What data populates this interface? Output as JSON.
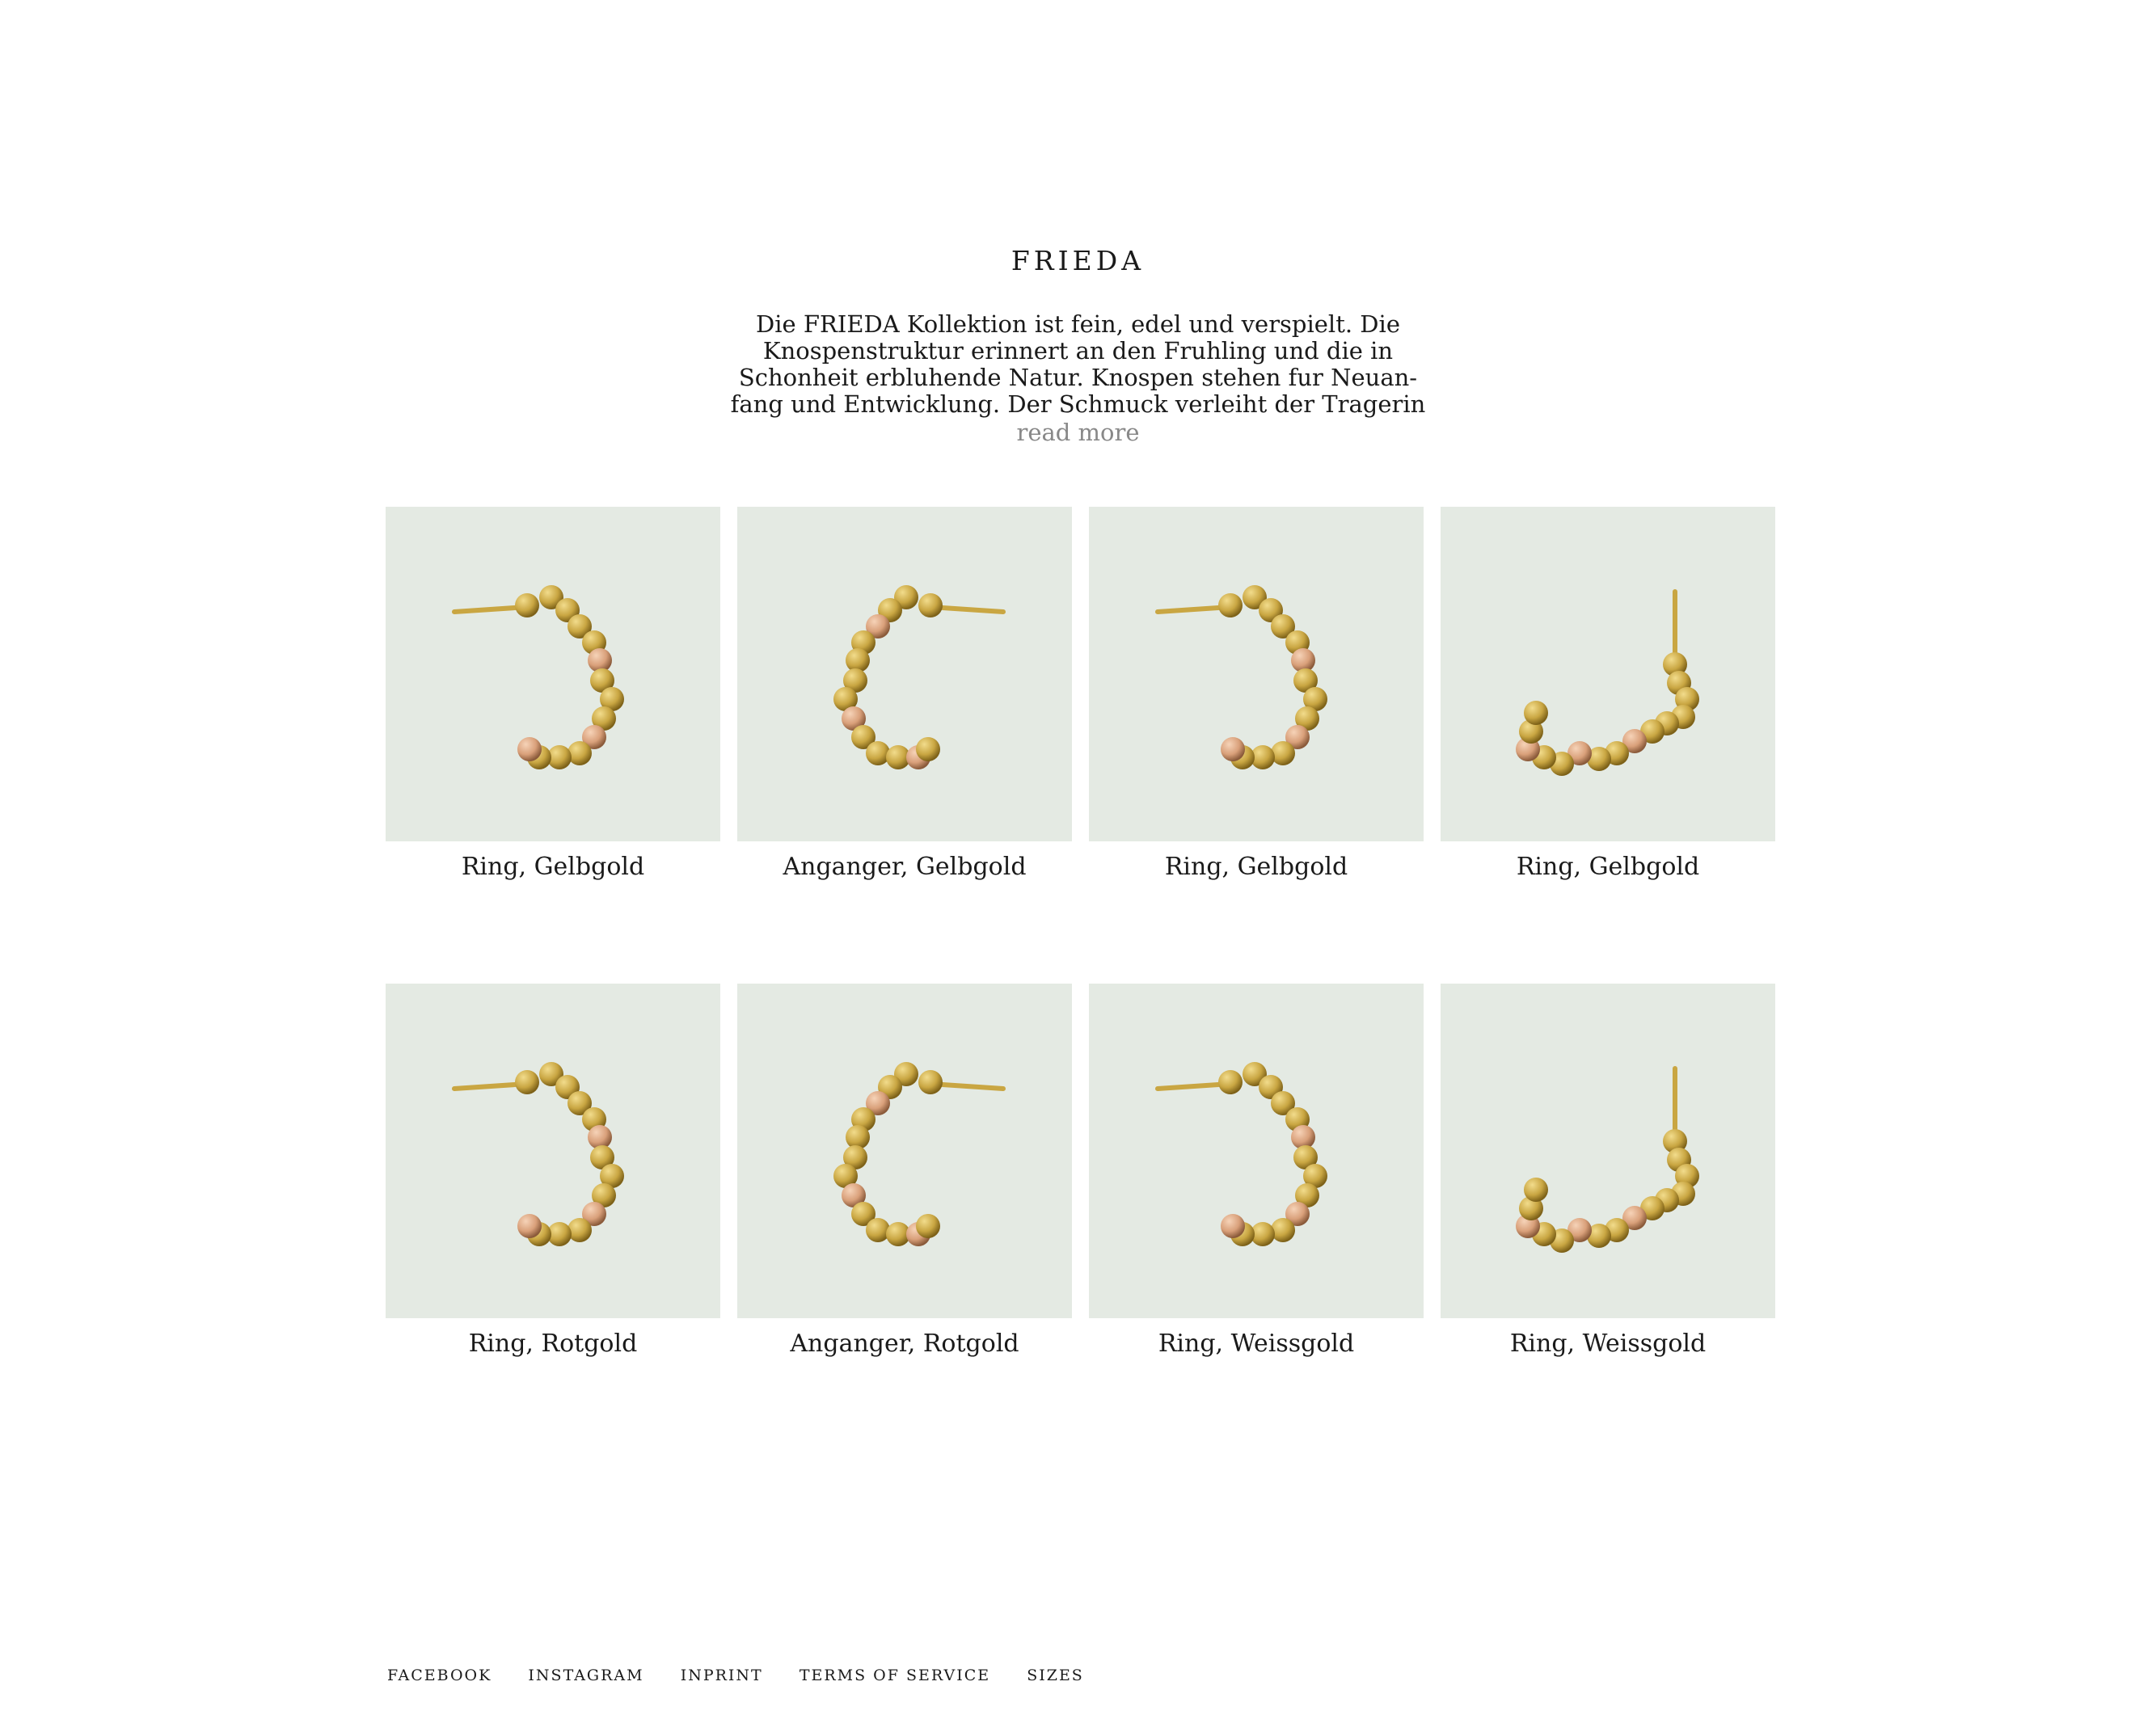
{
  "collection": {
    "title": "FRIEDA",
    "intro": "Die FRIEDA Kollektion ist fein, edel und verspielt. Die Knospenstruktur erinnert an den Fruhling und die in Schonheit erbluhende Natur. Knospen stehen fur Neuan-fang und Entwicklung. Der Schmuck verleiht der Tragerin",
    "read_more": "read more"
  },
  "products": [
    {
      "name": "Ring, Gelbgold",
      "image_icon": "hoop-earring-side-icon"
    },
    {
      "name": "Anganger, Gelbgold",
      "image_icon": "hoop-earring-mirrored-icon"
    },
    {
      "name": "Ring, Gelbgold",
      "image_icon": "hoop-earring-side-icon"
    },
    {
      "name": "Ring, Gelbgold",
      "image_icon": "hoop-earring-front-icon"
    },
    {
      "name": "Ring, Rotgold",
      "image_icon": "hoop-earring-side-icon"
    },
    {
      "name": "Anganger, Rotgold",
      "image_icon": "hoop-earring-mirrored-icon"
    },
    {
      "name": "Ring, Weissgold",
      "image_icon": "hoop-earring-side-icon"
    },
    {
      "name": "Ring, Weissgold",
      "image_icon": "hoop-earring-front-icon"
    }
  ],
  "footer": {
    "links": [
      "FACEBOOK",
      "INSTAGRAM",
      "INPRINT",
      "TERMS OF SERVICE",
      "SIZES"
    ]
  },
  "colors": {
    "thumb_background": "#e4eae3",
    "gold": "#c9a642",
    "gold_highlight": "#f2dc8c",
    "rose_gold": "#d9a07a",
    "read_more": "#888888"
  }
}
